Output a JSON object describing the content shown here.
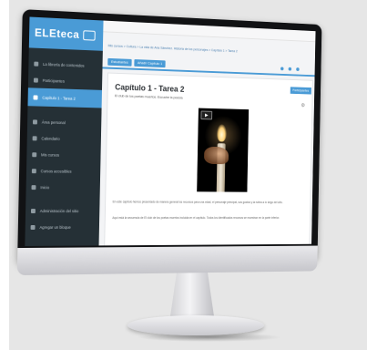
{
  "app": {
    "brand": "ELEteca"
  },
  "sidebar": {
    "items": [
      {
        "label": "La librería de contenidos"
      },
      {
        "label": "Participantes"
      },
      {
        "label": "Capítulo 1 - Tarea 2",
        "active": true
      },
      {
        "label": "Área personal"
      },
      {
        "label": "Calendario"
      },
      {
        "label": "Mis cursos"
      },
      {
        "label": "Cursos accesibles"
      },
      {
        "label": "Inicio"
      },
      {
        "label": "Administración del sitio"
      },
      {
        "label": "Agregar un bloque"
      }
    ]
  },
  "breadcrumb": "Mis cursos  >  Cultura  >  La vida de Ana Sánchez. Historia de los personajes  >  Capítulo 1  >  Tarea 2",
  "tabs": [
    "Estudiantes",
    "Añadir Capítulo 1"
  ],
  "card": {
    "title": "Capítulo 1 - Tarea 2",
    "subtitle": "El club de los poetas muertos. Escuche la poesía",
    "button": "Participantes",
    "paragraph_1": "En este capítulo hemos presentado de manera general los recursos para una edad, el personaje principal, sus gustos y la rutina a lo largo del año.",
    "paragraph_2": "Aquí está la secuencia de El club de los poetas muertos incluida en el capítulo. Todos los identificados recursos se muestran en la parte inferior."
  },
  "colors": {
    "accent": "#4a9bd6",
    "sidebar": "#253036"
  },
  "icons": [
    "play-icon",
    "gear-icon",
    "menu-icon"
  ]
}
